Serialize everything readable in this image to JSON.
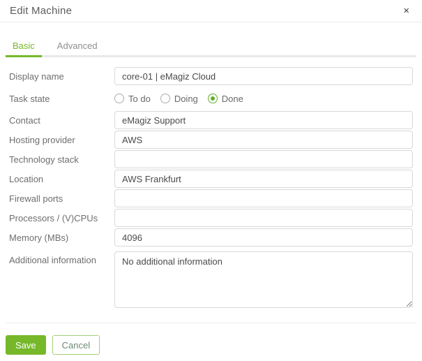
{
  "modal": {
    "title": "Edit Machine",
    "close_icon": "×"
  },
  "tabs": {
    "basic": {
      "label": "Basic",
      "active": true
    },
    "advanced": {
      "label": "Advanced",
      "active": false
    }
  },
  "form": {
    "display_name": {
      "label": "Display name",
      "value": "core-01 | eMagiz Cloud"
    },
    "task_state": {
      "label": "Task state",
      "options": {
        "todo": {
          "label": "To do",
          "selected": false
        },
        "doing": {
          "label": "Doing",
          "selected": false
        },
        "done": {
          "label": "Done",
          "selected": true
        }
      }
    },
    "contact": {
      "label": "Contact",
      "value": "eMagiz Support"
    },
    "hosting_provider": {
      "label": "Hosting provider",
      "value": "AWS"
    },
    "technology_stack": {
      "label": "Technology stack",
      "value": ""
    },
    "location": {
      "label": "Location",
      "value": "AWS Frankfurt"
    },
    "firewall_ports": {
      "label": "Firewall ports",
      "value": ""
    },
    "processors": {
      "label": "Processors / (V)CPUs",
      "value": ""
    },
    "memory": {
      "label": "Memory (MBs)",
      "value": "4096"
    },
    "additional_information": {
      "label": "Additional information",
      "value": "No additional information"
    }
  },
  "footer": {
    "save_label": "Save",
    "cancel_label": "Cancel"
  },
  "colors": {
    "accent_green": "#76b82a",
    "radio_selected_green": "#61ad29",
    "label_gray": "#6e6e6e",
    "input_border": "#d8d8d8"
  }
}
